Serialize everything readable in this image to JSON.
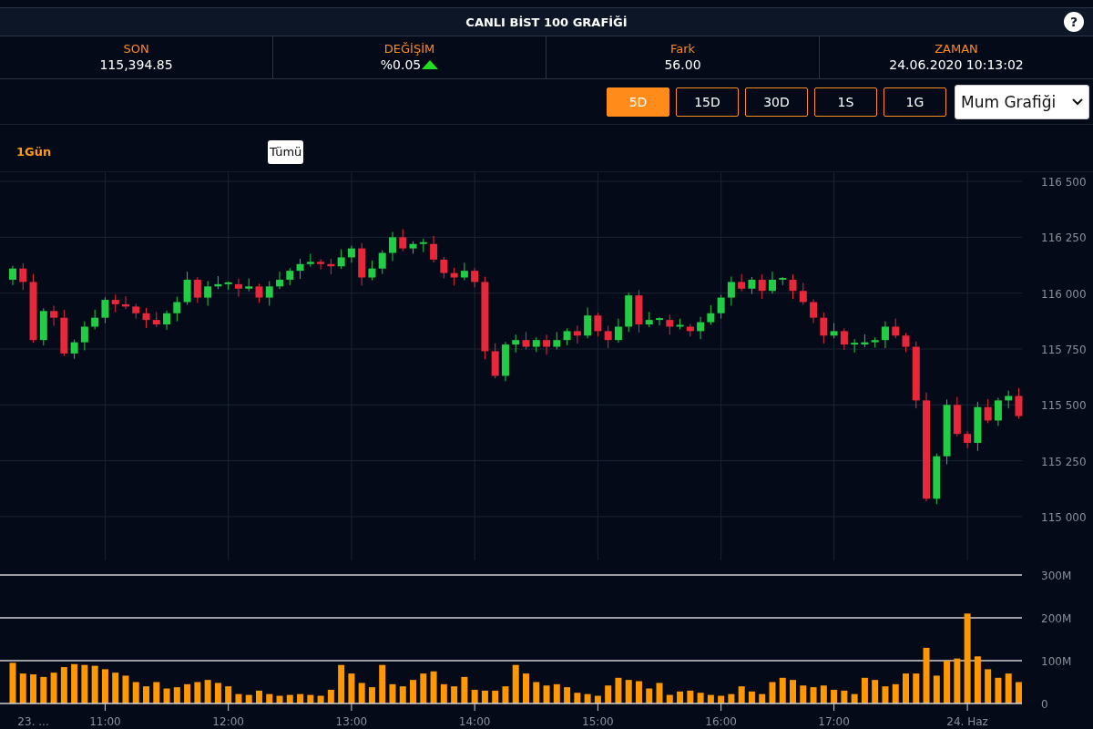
{
  "header": {
    "title": "CANLI BİST 100 GRAFİĞİ",
    "help": "?"
  },
  "stats": [
    {
      "label": "SON",
      "value": "115,394.85",
      "rising": false
    },
    {
      "label": "DEĞİŞİM",
      "value": "%0.05",
      "rising": true
    },
    {
      "label": "Fark",
      "value": "56.00",
      "rising": false
    },
    {
      "label": "ZAMAN",
      "value": "24.06.2020 10:13:02",
      "rising": false
    }
  ],
  "periods": [
    {
      "label": "5D",
      "selected": true
    },
    {
      "label": "15D",
      "selected": false
    },
    {
      "label": "30D",
      "selected": false
    },
    {
      "label": "1S",
      "selected": false
    },
    {
      "label": "1G",
      "selected": false
    }
  ],
  "chart_type": {
    "value": "Mum Grafiği"
  },
  "range": {
    "label": "1Gün",
    "button": "Tümü"
  },
  "price": {
    "chart_data": {
      "type": "candlestick",
      "grid": true,
      "ylim": [
        114804,
        116541
      ],
      "yticks": [
        {
          "value": 116500,
          "label": "116 500"
        },
        {
          "value": 116250,
          "label": "116 250"
        },
        {
          "value": 116000,
          "label": "116 000"
        },
        {
          "value": 115750,
          "label": "115 750"
        },
        {
          "value": 115500,
          "label": "115 500"
        },
        {
          "value": 115250,
          "label": "115 250"
        },
        {
          "value": 115000,
          "label": "115 000"
        }
      ],
      "categories": [
        null,
        null,
        null,
        null,
        null,
        null,
        null,
        null,
        null,
        null,
        null,
        null,
        null,
        null,
        null,
        null,
        null,
        null,
        null,
        null,
        null,
        null,
        null,
        null,
        null,
        null,
        null,
        null,
        null,
        null,
        null,
        null,
        null,
        null,
        null,
        null,
        null,
        null,
        null,
        null,
        null,
        null,
        null,
        null,
        null,
        null,
        null,
        null,
        null,
        null,
        null,
        null,
        null,
        null,
        null,
        null,
        null,
        null,
        null,
        null,
        null,
        null,
        null,
        null,
        null,
        null,
        null,
        null,
        null,
        null,
        null,
        null,
        null,
        null,
        null,
        null,
        null,
        null,
        null,
        null,
        null,
        null,
        null,
        null,
        null,
        null,
        null,
        null,
        null,
        null,
        null,
        null,
        null,
        null,
        null,
        null,
        null,
        null,
        null
      ],
      "ohlc": [
        [
          116060,
          116122,
          116036,
          116110
        ],
        [
          116110,
          116134,
          116014,
          116050
        ],
        [
          116050,
          116086,
          115778,
          115790
        ],
        [
          115790,
          115932,
          115766,
          115920
        ],
        [
          115920,
          115944,
          115854,
          115890
        ],
        [
          115890,
          115926,
          115718,
          115730
        ],
        [
          115730,
          115792,
          115706,
          115780
        ],
        [
          115780,
          115874,
          115744,
          115850
        ],
        [
          115850,
          115926,
          115838,
          115890
        ],
        [
          115890,
          115982,
          115866,
          115970
        ],
        [
          115970,
          115994,
          115914,
          115950
        ],
        [
          115950,
          115986,
          115928,
          115940
        ],
        [
          115940,
          115952,
          115886,
          115910
        ],
        [
          115910,
          115934,
          115844,
          115880
        ],
        [
          115880,
          115916,
          115848,
          115860
        ],
        [
          115860,
          115922,
          115836,
          115910
        ],
        [
          115910,
          115984,
          115874,
          115960
        ],
        [
          115960,
          116096,
          115948,
          116060
        ],
        [
          116060,
          116072,
          115956,
          115980
        ],
        [
          115980,
          116054,
          115944,
          116030
        ],
        [
          116030,
          116076,
          116018,
          116040
        ],
        [
          116040,
          116052,
          116016,
          116048
        ],
        [
          116040,
          116064,
          115984,
          116020
        ],
        [
          116020,
          116066,
          116008,
          116030
        ],
        [
          116030,
          116042,
          115956,
          115980
        ],
        [
          115980,
          116054,
          115944,
          116030
        ],
        [
          116030,
          116096,
          116018,
          116060
        ],
        [
          116060,
          116112,
          116036,
          116100
        ],
        [
          116100,
          116154,
          116064,
          116130
        ],
        [
          116130,
          116176,
          116118,
          116140
        ],
        [
          116140,
          116152,
          116106,
          116130
        ],
        [
          116130,
          116154,
          116084,
          116120
        ],
        [
          116120,
          116196,
          116108,
          116160
        ],
        [
          116160,
          116212,
          116136,
          116200
        ],
        [
          116200,
          116224,
          116034,
          116070
        ],
        [
          116070,
          116146,
          116058,
          116110
        ],
        [
          116110,
          116192,
          116086,
          116180
        ],
        [
          116180,
          116274,
          116144,
          116250
        ],
        [
          116250,
          116286,
          116188,
          116200
        ],
        [
          116200,
          116232,
          116176,
          116220
        ],
        [
          116220,
          116244,
          116184,
          116228
        ],
        [
          116220,
          116256,
          116138,
          116150
        ],
        [
          116150,
          116162,
          116066,
          116090
        ],
        [
          116090,
          116114,
          116034,
          116070
        ],
        [
          116070,
          116136,
          116058,
          116100
        ],
        [
          116100,
          116112,
          116026,
          116050
        ],
        [
          116050,
          116074,
          115704,
          115740
        ],
        [
          115740,
          115776,
          115618,
          115630
        ],
        [
          115630,
          115782,
          115606,
          115770
        ],
        [
          115770,
          115814,
          115734,
          115790
        ],
        [
          115790,
          115826,
          115748,
          115760
        ],
        [
          115760,
          115802,
          115736,
          115790
        ],
        [
          115790,
          115814,
          115724,
          115760
        ],
        [
          115760,
          115826,
          115748,
          115790
        ],
        [
          115790,
          115842,
          115766,
          115830
        ],
        [
          115830,
          115854,
          115774,
          115810
        ],
        [
          115810,
          115936,
          115798,
          115900
        ],
        [
          115900,
          115912,
          115806,
          115830
        ],
        [
          115830,
          115854,
          115754,
          115790
        ],
        [
          115790,
          115886,
          115778,
          115850
        ],
        [
          115850,
          116002,
          115826,
          115990
        ],
        [
          115990,
          116014,
          115824,
          115860
        ],
        [
          115860,
          115916,
          115848,
          115880
        ],
        [
          115880,
          115892,
          115856,
          115888
        ],
        [
          115880,
          115904,
          115814,
          115850
        ],
        [
          115850,
          115886,
          115838,
          115858
        ],
        [
          115850,
          115862,
          115806,
          115830
        ],
        [
          115830,
          115894,
          115794,
          115870
        ],
        [
          115870,
          115946,
          115858,
          115910
        ],
        [
          115910,
          115992,
          115886,
          115980
        ],
        [
          115980,
          116074,
          115944,
          116050
        ],
        [
          116050,
          116086,
          116008,
          116020
        ],
        [
          116020,
          116072,
          115996,
          116060
        ],
        [
          116060,
          116084,
          115974,
          116010
        ],
        [
          116010,
          116096,
          115998,
          116060
        ],
        [
          116060,
          116072,
          116036,
          116068
        ],
        [
          116060,
          116084,
          115974,
          116010
        ],
        [
          116010,
          116046,
          115948,
          115960
        ],
        [
          115960,
          115972,
          115866,
          115890
        ],
        [
          115890,
          115914,
          115774,
          115810
        ],
        [
          115810,
          115866,
          115798,
          115830
        ],
        [
          115830,
          115842,
          115746,
          115770
        ],
        [
          115770,
          115794,
          115734,
          115778
        ],
        [
          115770,
          115816,
          115758,
          115780
        ],
        [
          115780,
          115802,
          115756,
          115790
        ],
        [
          115790,
          115874,
          115754,
          115850
        ],
        [
          115850,
          115886,
          115798,
          115810
        ],
        [
          115810,
          115822,
          115736,
          115760
        ],
        [
          115760,
          115784,
          115484,
          115520
        ],
        [
          115520,
          115556,
          115068,
          115080
        ],
        [
          115080,
          115282,
          115056,
          115270
        ],
        [
          115270,
          115524,
          115234,
          115500
        ],
        [
          115500,
          115536,
          115358,
          115370
        ],
        [
          115370,
          115382,
          115306,
          115330
        ],
        [
          115330,
          115514,
          115294,
          115490
        ],
        [
          115490,
          115526,
          115418,
          115430
        ],
        [
          115430,
          115532,
          115406,
          115520
        ],
        [
          115520,
          115564,
          115484,
          115540
        ],
        [
          115540,
          115576,
          115438,
          115450
        ]
      ]
    }
  },
  "volume": {
    "chart_data": {
      "type": "bar",
      "ylim": [
        0,
        300
      ],
      "yticks": [
        {
          "value": 0,
          "label": "0"
        },
        {
          "value": 100,
          "label": "100M"
        },
        {
          "value": 200,
          "label": "200M"
        },
        {
          "value": 300,
          "label": "300M"
        }
      ],
      "categories": [
        null,
        null,
        "23. ...",
        null,
        null,
        null,
        null,
        null,
        null,
        "11:00",
        null,
        null,
        null,
        null,
        null,
        null,
        null,
        null,
        null,
        null,
        null,
        "12:00",
        null,
        null,
        null,
        null,
        null,
        null,
        null,
        null,
        null,
        null,
        null,
        "13:00",
        null,
        null,
        null,
        null,
        null,
        null,
        null,
        null,
        null,
        null,
        null,
        "14:00",
        null,
        null,
        null,
        null,
        null,
        null,
        null,
        null,
        null,
        null,
        null,
        "15:00",
        null,
        null,
        null,
        null,
        null,
        null,
        null,
        null,
        null,
        null,
        null,
        "16:00",
        null,
        null,
        null,
        null,
        null,
        null,
        null,
        null,
        null,
        null,
        "17:00",
        null,
        null,
        null,
        null,
        null,
        null,
        null,
        null,
        null,
        null,
        null,
        null,
        "24. Haz",
        null,
        null,
        null,
        null,
        null
      ],
      "series": [
        {
          "color": "#ff9800",
          "values": [
            95,
            70,
            68,
            62,
            72,
            85,
            92,
            90,
            88,
            80,
            72,
            65,
            50,
            40,
            50,
            35,
            38,
            45,
            50,
            55,
            48,
            40,
            22,
            20,
            30,
            22,
            18,
            20,
            22,
            20,
            18,
            32,
            90,
            70,
            48,
            38,
            90,
            45,
            40,
            55,
            70,
            75,
            45,
            40,
            62,
            32,
            30,
            30,
            40,
            90,
            70,
            50,
            42,
            45,
            38,
            25,
            22,
            18,
            42,
            60,
            55,
            52,
            35,
            48,
            20,
            28,
            30,
            25,
            20,
            18,
            22,
            40,
            28,
            22,
            50,
            60,
            55,
            42,
            38,
            42,
            32,
            30,
            22,
            60,
            55,
            40,
            45,
            70,
            70,
            130,
            65,
            100,
            105,
            210,
            110,
            80,
            60,
            70,
            50
          ]
        }
      ]
    }
  }
}
